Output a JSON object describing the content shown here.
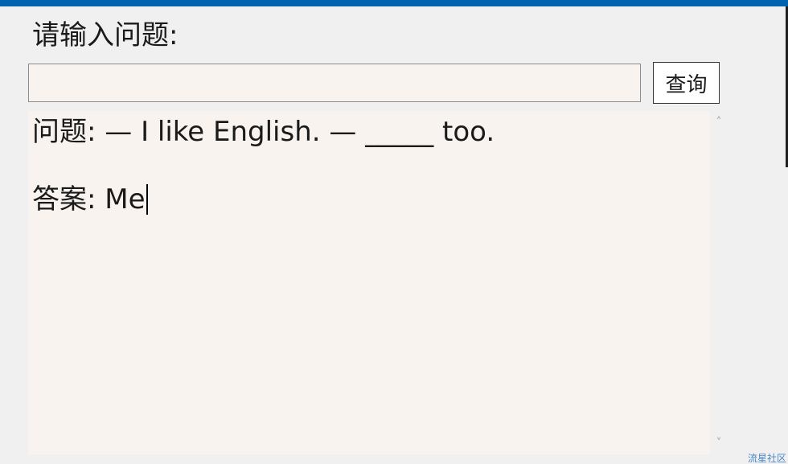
{
  "form": {
    "prompt_label": "请输入问题:",
    "input_value": "",
    "query_button_label": "查询"
  },
  "output": {
    "question_line": "问题: — I like English. — _____ too.",
    "answer_line": "答案: Me"
  },
  "scrollbar": {
    "up_arrow": "˄",
    "down_arrow": "˅"
  },
  "watermark": "流星社区",
  "colors": {
    "title_bar": "#0063b1",
    "panel_background": "#f8f3ee",
    "window_background": "#f0f0f0",
    "watermark": "#4a86c8"
  }
}
